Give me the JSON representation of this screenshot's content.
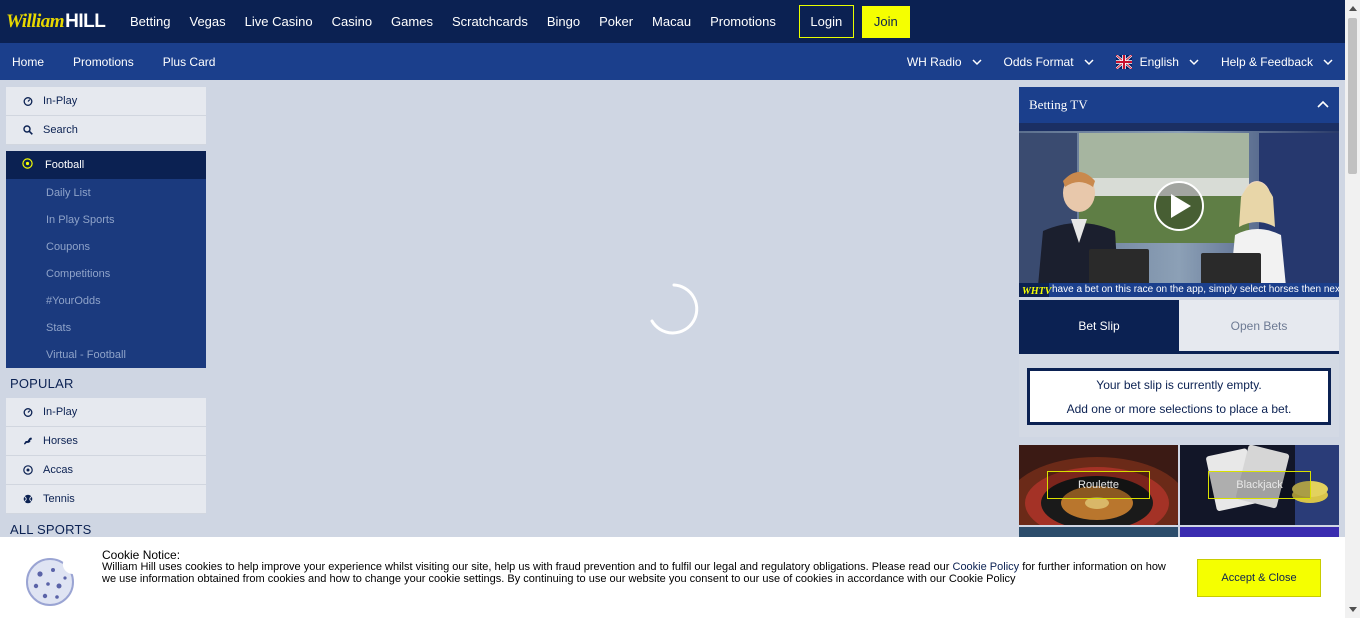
{
  "header": {
    "logo_script": "William",
    "logo_bold": "HILL",
    "nav": [
      "Betting",
      "Vegas",
      "Live Casino",
      "Casino",
      "Games",
      "Scratchcards",
      "Bingo",
      "Poker",
      "Macau",
      "Promotions"
    ],
    "login_label": "Login",
    "join_label": "Join"
  },
  "subnav": {
    "left": [
      "Home",
      "Promotions",
      "Plus Card"
    ],
    "wh_radio": "WH Radio",
    "odds_format": "Odds Format",
    "language": "English",
    "help": "Help & Feedback"
  },
  "sidebar": {
    "top_items": [
      {
        "label": "In-Play",
        "icon": "stopwatch-icon"
      },
      {
        "label": "Search",
        "icon": "search-icon"
      }
    ],
    "football": {
      "label": "Football",
      "sub_items": [
        "Daily List",
        "In Play Sports",
        "Coupons",
        "Competitions",
        "#YourOdds",
        "Stats",
        "Virtual - Football"
      ]
    },
    "popular_heading": "POPULAR",
    "popular_items": [
      {
        "label": "In-Play",
        "icon": "stopwatch-icon"
      },
      {
        "label": "Horses",
        "icon": "horse-icon"
      },
      {
        "label": "Accas",
        "icon": "football-icon"
      },
      {
        "label": "Tennis",
        "icon": "tennis-ball-icon"
      }
    ],
    "all_sports_heading": "ALL SPORTS"
  },
  "betting_tv": {
    "title": "Betting TV",
    "ticker": "have a bet on this race on the app, simply select horses then next c"
  },
  "betslip": {
    "tab_bet_slip": "Bet Slip",
    "tab_open_bets": "Open Bets",
    "empty_line1": "Your bet slip is currently empty.",
    "empty_line2": "Add one or more selections to place a bet."
  },
  "promos": [
    {
      "label": "Roulette"
    },
    {
      "label": "Blackjack"
    }
  ],
  "cookie": {
    "title": "Cookie Notice:",
    "text_before": "William Hill uses cookies to help improve your experience whilst visiting our site, help us with fraud prevention and to fulfil our legal and regulatory obligations. Please read our ",
    "link_text": "Cookie Policy",
    "text_after": " for further information on how we use information obtained from cookies and how to change your cookie settings. By continuing to use our website you consent to our use of cookies in accordance with our Cookie Policy",
    "accept_label": "Accept & Close"
  },
  "colors": {
    "navy": "#0b2152",
    "blue": "#1b3f8c",
    "yellow": "#f5ff00",
    "background": "#cfd6e3"
  }
}
